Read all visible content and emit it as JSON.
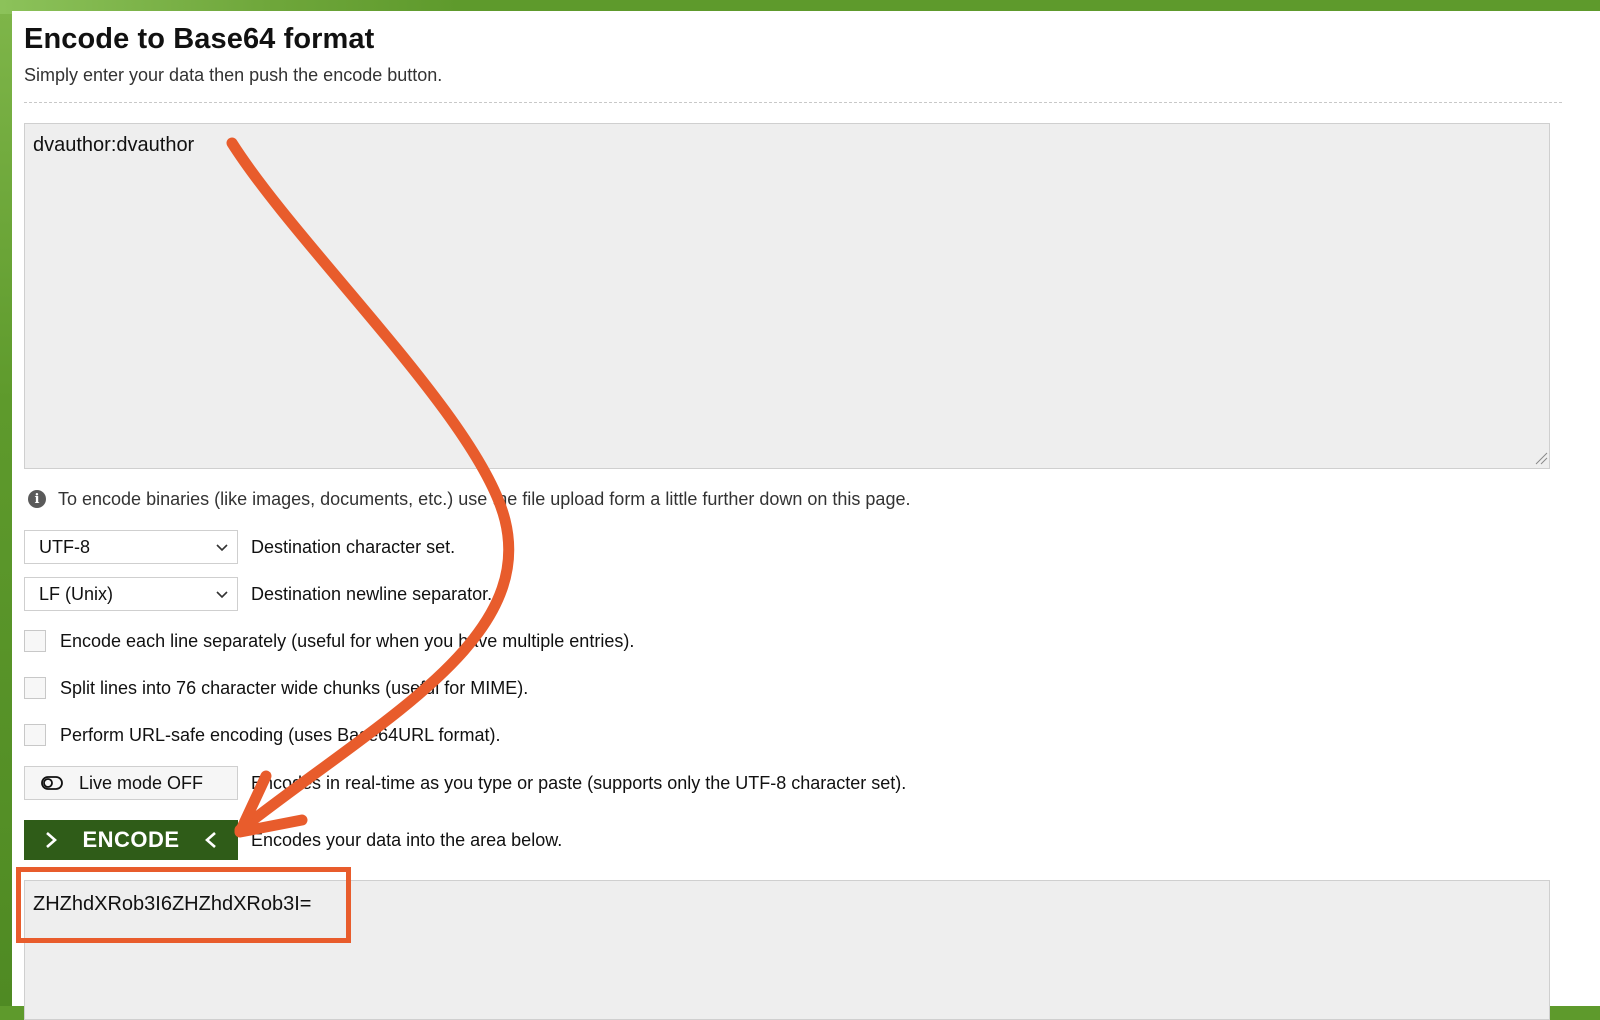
{
  "page": {
    "title": "Encode to Base64 format",
    "subtitle": "Simply enter your data then push the encode button."
  },
  "input": {
    "value": "dvauthor:dvauthor"
  },
  "info": {
    "text": "To encode binaries (like images, documents, etc.) use the file upload form a little further down on this page."
  },
  "options": {
    "charset": {
      "selected": "UTF-8",
      "label": "Destination character set."
    },
    "newline": {
      "selected": "LF (Unix)",
      "label": "Destination newline separator."
    },
    "checkboxes": [
      {
        "label": "Encode each line separately (useful for when you have multiple entries).",
        "checked": false
      },
      {
        "label": "Split lines into 76 character wide chunks (useful for MIME).",
        "checked": false
      },
      {
        "label": "Perform URL-safe encoding (uses Base64URL format).",
        "checked": false
      }
    ],
    "live_mode": {
      "label": "Live mode OFF",
      "description": "Encodes in real-time as you type or paste (supports only the UTF-8 character set)."
    }
  },
  "encode": {
    "label": "ENCODE",
    "description": "Encodes your data into the area below."
  },
  "output": {
    "value": "ZHZhdXRob3I6ZHZhdXRob3I="
  },
  "colors": {
    "frame_green": "#5e9a2c",
    "button_green": "#2f5c18",
    "annotation_orange": "#e85c2c",
    "textarea_bg": "#eeeeee"
  }
}
